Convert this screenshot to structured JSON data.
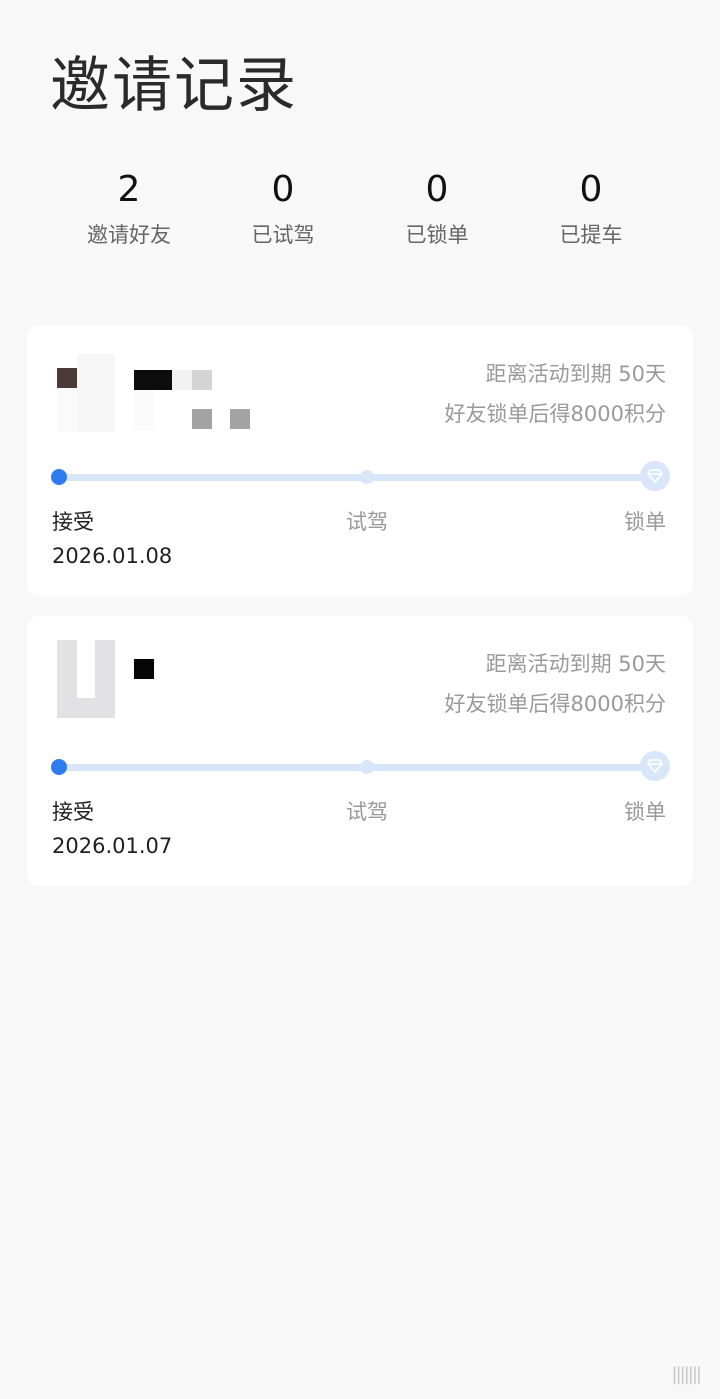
{
  "page": {
    "title": "邀请记录"
  },
  "stats": [
    {
      "value": "2",
      "label": "邀请好友"
    },
    {
      "value": "0",
      "label": "已试驾"
    },
    {
      "value": "0",
      "label": "已锁单"
    },
    {
      "value": "0",
      "label": "已提车"
    }
  ],
  "records": [
    {
      "days_left": "距离活动到期 50天",
      "reward": "好友锁单后得8000积分",
      "stages": [
        "接受",
        "试驾",
        "锁单"
      ],
      "date": "2026.01.08",
      "progress": 0
    },
    {
      "days_left": "距离活动到期 50天",
      "reward": "好友锁单后得8000积分",
      "stages": [
        "接受",
        "试驾",
        "锁单"
      ],
      "date": "2026.01.07",
      "progress": 0
    }
  ],
  "colors": {
    "accent": "#2f7cf0",
    "track": "#d9e6fa",
    "background": "#f8f8f8"
  },
  "icons": {
    "track_end": "diamond-icon"
  },
  "watermark": "|||||||"
}
